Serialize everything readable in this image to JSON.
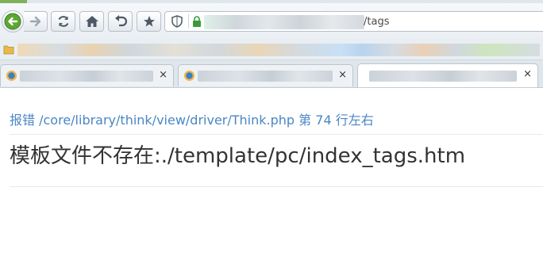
{
  "browser": {
    "address_bar": {
      "visible_url_suffix": "/tags"
    },
    "tabs": [
      {
        "close_label": "×"
      },
      {
        "close_label": "×"
      },
      {
        "close_label": "×",
        "active": true
      }
    ]
  },
  "error_page": {
    "location": {
      "label": "报错",
      "file": "/core/library/think/view/driver/Think.php",
      "line_prefix": "第",
      "line_number": "74",
      "line_suffix": "行左右"
    },
    "message": "模板文件不存在:./template/pc/index_tags.htm"
  },
  "colors": {
    "link_blue": "#4a86c5",
    "message_text": "#333333"
  }
}
